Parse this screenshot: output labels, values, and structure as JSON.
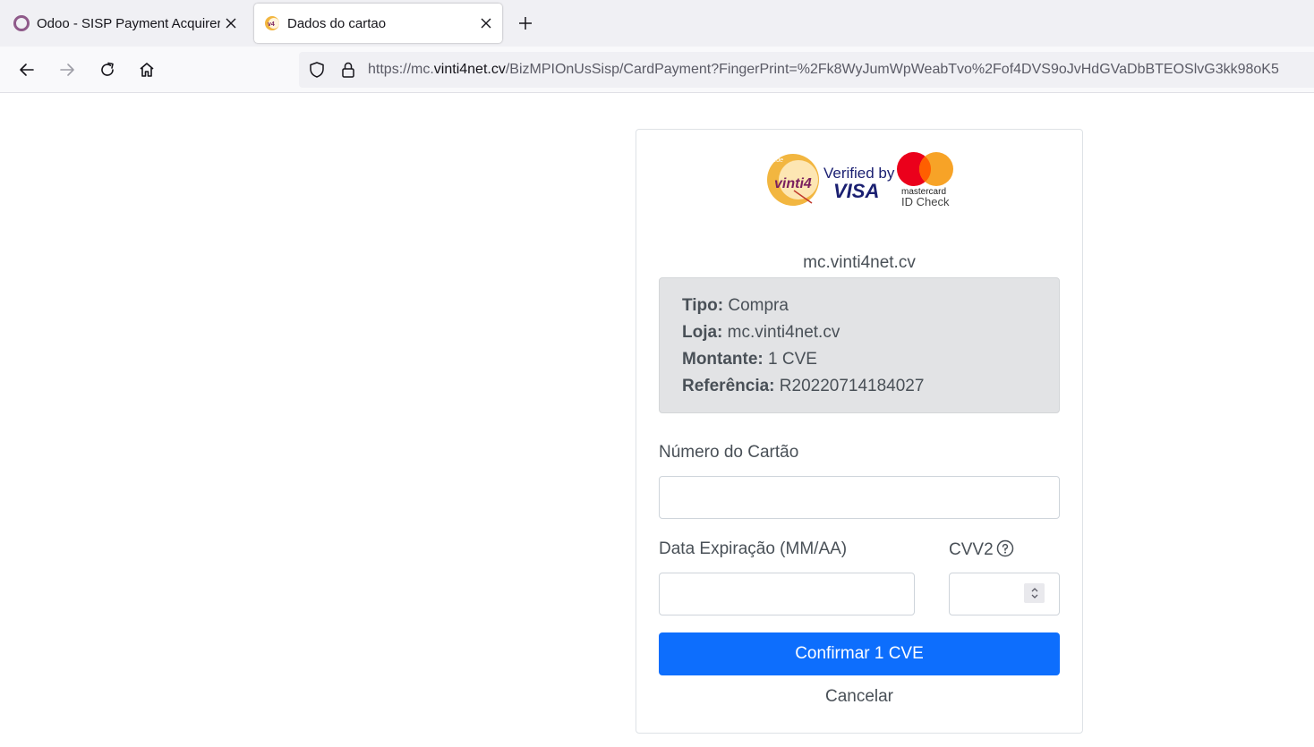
{
  "browser": {
    "tabs": [
      {
        "title": "Odoo - SISP Payment Acquirer",
        "active": false
      },
      {
        "title": "Dados do cartao",
        "active": true
      }
    ],
    "url": {
      "prefix": "https://mc.",
      "domain": "vinti4net.cv",
      "path": "/BizMPIOnUsSisp/CardPayment?FingerPrint=%2Fk8WyJumWpWeabTvo%2Fof4DVS9oJvHdGVaDbBTEOSlvG3kk98oK5"
    }
  },
  "logos": {
    "vinti4_rede": "rede",
    "vinti4_text": "vinti4",
    "verified_by": "Verified by",
    "visa": "VISA",
    "mastercard": "mastercard",
    "id_check": "ID Check"
  },
  "payment": {
    "merchant_host": "mc.vinti4net.cv",
    "details": {
      "tipo_label": "Tipo:",
      "tipo_value": "Compra",
      "loja_label": "Loja:",
      "loja_value": "mc.vinti4net.cv",
      "montante_label": "Montante:",
      "montante_value": "1 CVE",
      "referencia_label": "Referência:",
      "referencia_value": "R20220714184027"
    }
  },
  "form": {
    "card_number_label": "Número do Cartão",
    "card_number_value": "",
    "expiry_label": "Data Expiração (MM/AA)",
    "expiry_value": "",
    "cvv_label": "CVV2",
    "cvv_value": "",
    "confirm_label": "Confirmar 1 CVE",
    "cancel_label": "Cancelar"
  },
  "colors": {
    "primary": "#0d6efd",
    "info_box_bg": "#e2e3e5",
    "text": "#495057",
    "mastercard_red": "#eb001b",
    "mastercard_orange": "#f79e1b",
    "visa_blue": "#1a1f71"
  }
}
